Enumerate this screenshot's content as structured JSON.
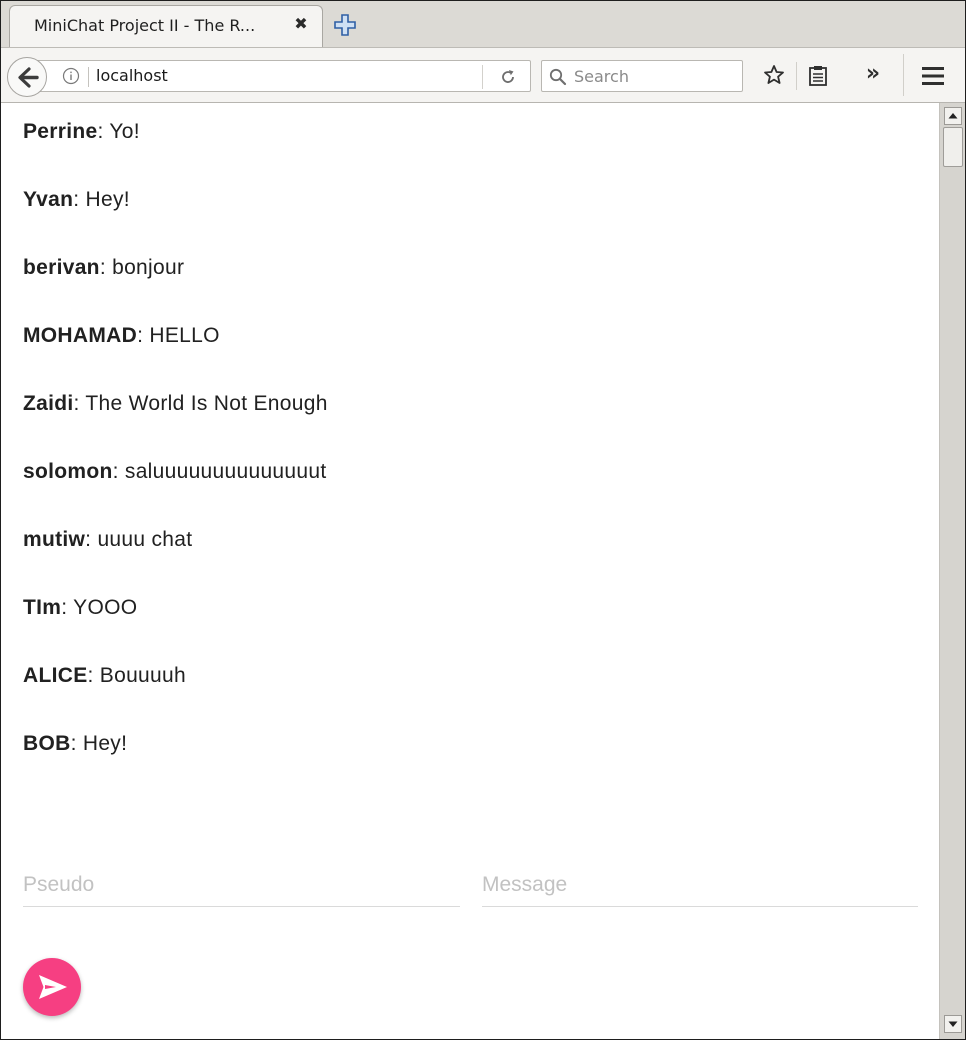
{
  "browser": {
    "tab_title": "MiniChat Project II - The R...",
    "tab_close_glyph": "✖",
    "url": "localhost",
    "search_placeholder": "Search",
    "overflow_glyph": "»"
  },
  "messages": [
    {
      "author": "Perrine",
      "separator": ": ",
      "text": "Yo!"
    },
    {
      "author": "Yvan",
      "separator": ": ",
      "text": "Hey!"
    },
    {
      "author": "berivan",
      "separator": ": ",
      "text": "bonjour"
    },
    {
      "author": "MOHAMAD",
      "separator": ": ",
      "text": "HELLO"
    },
    {
      "author": "Zaidi",
      "separator": ": ",
      "text": "The World Is Not Enough"
    },
    {
      "author": "solomon",
      "separator": ": ",
      "text": "saluuuuuuuuuuuuuut"
    },
    {
      "author": "mutiw",
      "separator": ": ",
      "text": "uuuu chat"
    },
    {
      "author": "TIm",
      "separator": ": ",
      "text": "YOOO"
    },
    {
      "author": "ALICE",
      "separator": ": ",
      "text": "Bouuuuh"
    },
    {
      "author": "BOB",
      "separator": ": ",
      "text": "Hey!"
    }
  ],
  "form": {
    "pseudo_placeholder": "Pseudo",
    "pseudo_value": "",
    "message_placeholder": "Message",
    "message_value": ""
  },
  "colors": {
    "send_button": "#f63f82",
    "text": "#212121",
    "placeholder": "#c2c2c2"
  },
  "icons": {
    "back": "back-arrow-icon",
    "info": "info-icon",
    "reload": "reload-icon",
    "search": "search-icon",
    "bookmark": "star-icon",
    "reading_list": "reading-list-icon",
    "overflow": "chevron-double-right-icon",
    "menu": "hamburger-menu-icon",
    "new_tab": "plus-icon",
    "send": "send-arrow-icon"
  }
}
